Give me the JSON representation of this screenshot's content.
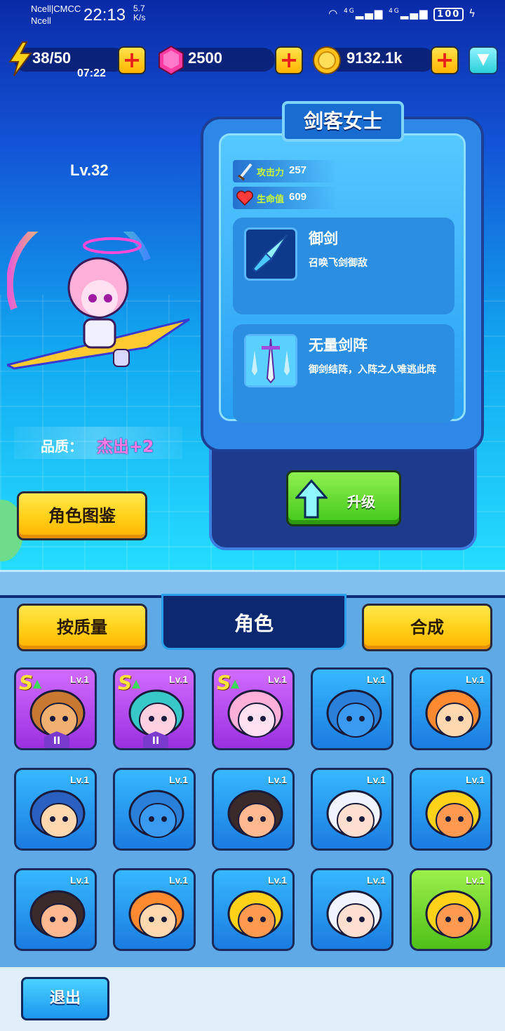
{
  "status_bar": {
    "carrier1": "Ncell|CMCC",
    "carrier2": "Ncell",
    "time": "22:13",
    "speed_value": "5.7",
    "speed_unit": "K/s",
    "network1": "4G",
    "network2": "4G",
    "battery": "100"
  },
  "resources": {
    "energy": "38/50",
    "energy_timer": "07:22",
    "gems": "2500",
    "coins": "9132.1k"
  },
  "hero": {
    "level": "Lv.32",
    "name": "剑客女士",
    "quality_label": "品质：",
    "quality_value": "杰出+2",
    "attack_label": "攻击力",
    "attack_value": "257",
    "hp_label": "生命值",
    "hp_value": "609",
    "skills": [
      {
        "name": "御剑",
        "desc": "召唤飞剑御敌",
        "icon": "flying-sword-icon"
      },
      {
        "name": "无量剑阵",
        "desc": "御剑结阵，入阵之人难逃此阵",
        "icon": "sword-formation-icon"
      }
    ]
  },
  "buttons": {
    "codex": "角色图鉴",
    "upgrade": "升级",
    "sort": "按质量",
    "tab": "角色",
    "merge": "合成",
    "exit": "退出"
  },
  "colors": {
    "purple_card": "#b24cf0",
    "blue_card": "#2a9af0",
    "green_card": "#6ed82e",
    "accent_yellow": "#ffd21a"
  },
  "roster": [
    {
      "lv": "Lv.1",
      "rarity": "purple",
      "badge": "II",
      "s_rank": true,
      "face": "monkey"
    },
    {
      "lv": "Lv.1",
      "rarity": "purple",
      "badge": "II",
      "s_rank": true,
      "face": "cat-girl"
    },
    {
      "lv": "Lv.1",
      "rarity": "purple",
      "badge": "",
      "s_rank": true,
      "face": "sword-lady"
    },
    {
      "lv": "Lv.1",
      "rarity": "blue",
      "badge": "",
      "s_rank": false,
      "face": "blue-monster"
    },
    {
      "lv": "Lv.1",
      "rarity": "blue",
      "badge": "",
      "s_rank": false,
      "face": "ram-girl"
    },
    {
      "lv": "Lv.1",
      "rarity": "blue",
      "badge": "",
      "s_rank": false,
      "face": "hooded-girl"
    },
    {
      "lv": "Lv.1",
      "rarity": "blue",
      "badge": "",
      "s_rank": false,
      "face": "blue-monster"
    },
    {
      "lv": "Lv.1",
      "rarity": "blue",
      "badge": "",
      "s_rank": false,
      "face": "mustache-man"
    },
    {
      "lv": "Lv.1",
      "rarity": "blue",
      "badge": "",
      "s_rank": false,
      "face": "white-hair"
    },
    {
      "lv": "Lv.1",
      "rarity": "blue",
      "badge": "",
      "s_rank": false,
      "face": "bearded-king"
    },
    {
      "lv": "Lv.1",
      "rarity": "blue",
      "badge": "",
      "s_rank": false,
      "face": "mustache-man"
    },
    {
      "lv": "Lv.1",
      "rarity": "blue",
      "badge": "",
      "s_rank": false,
      "face": "ram-girl"
    },
    {
      "lv": "Lv.1",
      "rarity": "blue",
      "badge": "",
      "s_rank": false,
      "face": "bearded-king"
    },
    {
      "lv": "Lv.1",
      "rarity": "blue",
      "badge": "",
      "s_rank": false,
      "face": "white-hair"
    },
    {
      "lv": "Lv.1",
      "rarity": "green",
      "badge": "",
      "s_rank": false,
      "face": "bearded-king"
    }
  ]
}
